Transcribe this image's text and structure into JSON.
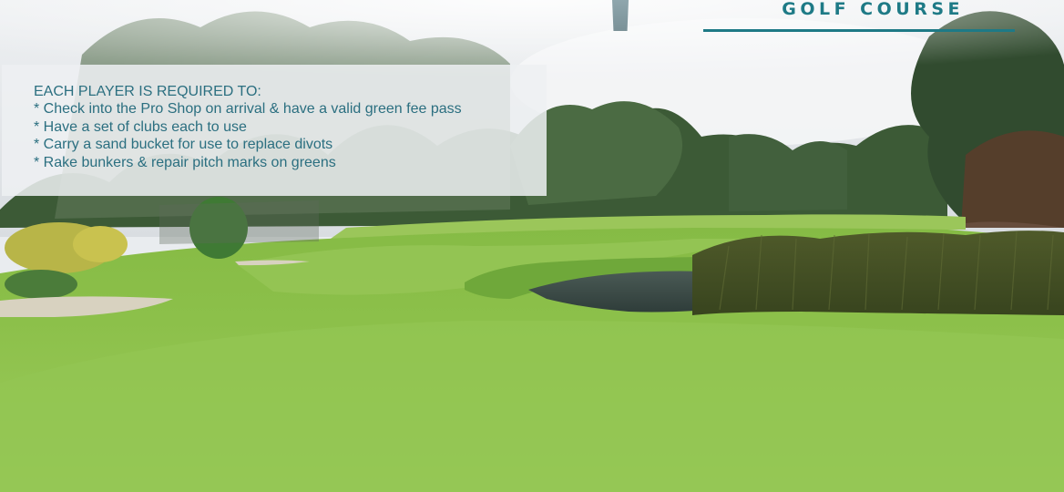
{
  "brand": {
    "title": "GOLF COURSE",
    "color": "#1e7a86"
  },
  "rules": {
    "heading": "EACH PLAYER IS REQUIRED TO:",
    "items": [
      "* Check into the Pro Shop on arrival & have a valid green fee pass",
      "* Have a set of clubs each to use",
      "* Carry a sand bucket for use to replace divots",
      "* Rake bunkers & repair pitch marks on greens"
    ],
    "text_color": "#2b6f80"
  },
  "photo": {
    "subject": "golf course fairway with pond, reeds and eucalyptus trees"
  }
}
